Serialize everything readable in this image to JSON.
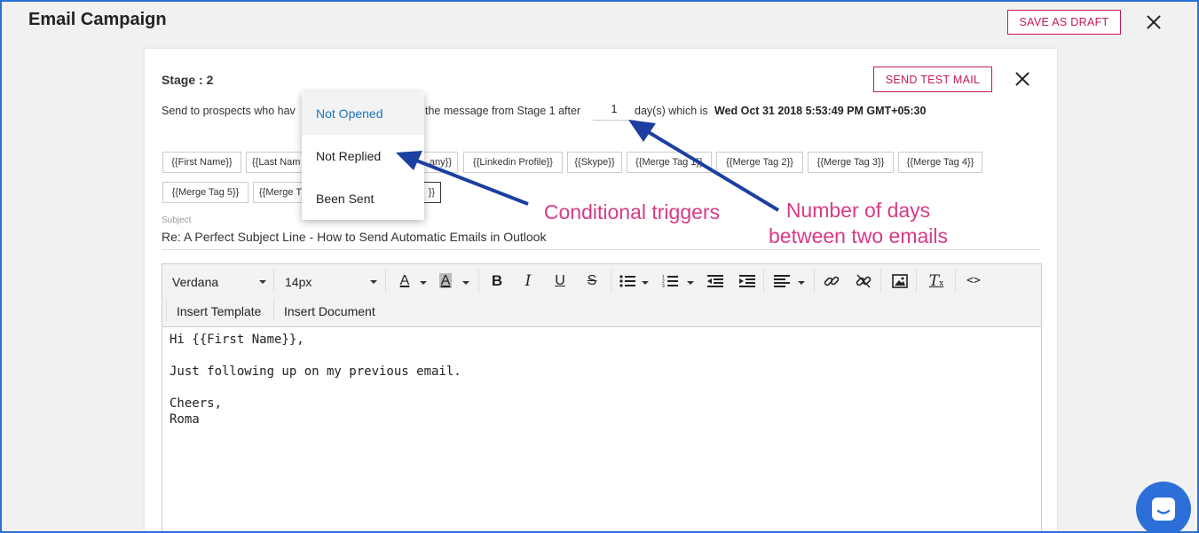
{
  "header": {
    "title": "Email Campaign",
    "save_draft_label": "SAVE AS DRAFT"
  },
  "stage": {
    "label": "Stage : 2",
    "send_test_label": "SEND TEST MAIL",
    "sentence_prefix": "Send to prospects who hav",
    "sentence_middle": "the message from Stage 1 after",
    "days_value": "1",
    "sentence_suffix": "day(s) which is",
    "scheduled_date": "Wed Oct 31 2018 5:53:49 PM GMT+05:30"
  },
  "condition_dropdown": {
    "selected": "Not Opened",
    "options": [
      "Not Opened",
      "Not Replied",
      "Been Sent"
    ]
  },
  "merge_tags": [
    "{{First Name}}",
    "{{Last Nam",
    "any}}",
    "{{Linkedin Profile}}",
    "{{Skype}}",
    "{{Merge Tag 1}}",
    "{{Merge Tag 2}}",
    "{{Merge Tag 3}}",
    "{{Merge Tag 4}}",
    "{{Merge Tag 5}}",
    "{{Merge T",
    "}}"
  ],
  "subject": {
    "label": "Subject",
    "value": "Re: A Perfect Subject Line - How to Send Automatic Emails in Outlook"
  },
  "toolbar": {
    "font_family": "Verdana",
    "font_size": "14px",
    "insert_template": "Insert Template",
    "insert_document": "Insert Document"
  },
  "email_body": {
    "line1": "Hi {{First Name}},",
    "line2": "Just following up on my previous email.",
    "line3": "Cheers,",
    "line4": "Roma"
  },
  "annotations": {
    "conditional_triggers": "Conditional triggers",
    "days_line1": "Number of days",
    "days_line2": "between two emails"
  },
  "colors": {
    "accent": "#c2185b",
    "frame": "#2c6fd8",
    "annotation": "#d63b84",
    "arrow": "#1a3fa0"
  }
}
